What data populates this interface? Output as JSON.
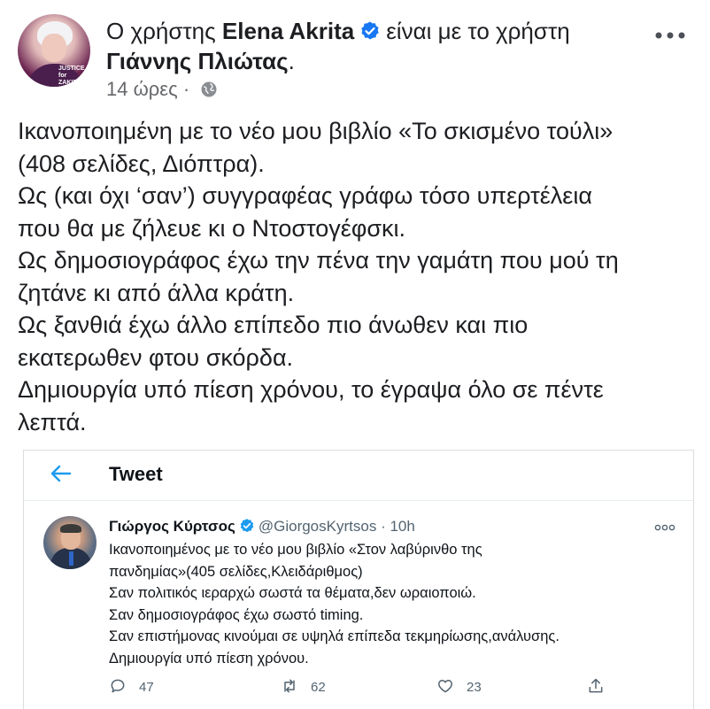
{
  "post": {
    "prefix": "Ο χρήστης",
    "author": "Elena Akrita",
    "with_text": "είναι με το χρήστη",
    "tagged": "Γιάννης Πλιώτας",
    "tagged_suffix": ".",
    "time": "14 ώρες",
    "dot": "·",
    "avatar_text": "JUSTICE for ZAKIE",
    "lines": [
      "Ικανοποιημένη με το νέο μου βιβλίο «Το σκισμένο τούλι»",
      "(408 σελίδες, Διόπτρα).",
      "Ως (και όχι ‘σαν’) συγγραφέας γράφω τόσο υπερτέλεια",
      "που θα με ζήλευε κι ο Ντοστογέφσκι.",
      "Ως δημοσιογράφος έχω την πένα την γαμάτη που μού τη",
      "ζητάνε κι από άλλα κράτη.",
      "Ως ξανθιά έχω άλλο επίπεδο πιο άνωθεν και πιο",
      "εκατερωθεν φτου σκόρδα.",
      "Δημιουργία υπό πίεση χρόνου, το έγραψα όλο σε πέντε",
      "λεπτά."
    ]
  },
  "tweet": {
    "title": "Tweet",
    "name": "Γιώργος Κύρτσος",
    "handle": "@GiorgosKyrtsos",
    "sep": "·",
    "time": "10h",
    "lines": [
      "Ικανοποιημένος με το νέο μου βιβλίο «Στον λαβύρινθο της",
      "πανδημίας»(405 σελίδες,Κλειδάριθμος)",
      "Σαν πολιτικός ιεραρχώ σωστά τα θέματα,δεν ωραιοποιώ.",
      "Σαν δημοσιογράφος έχω σωστό timing.",
      "Σαν επιστήμονας κινούμαι σε υψηλά επίπεδα τεκμηρίωσης,ανάλυσης.",
      "Δημιουργία υπό πίεση χρόνου."
    ],
    "replies": "47",
    "retweets": "62",
    "likes": "23"
  },
  "colors": {
    "verified": "#1877f2",
    "twitter_blue": "#1d9bf0",
    "muted": "#65676b"
  }
}
